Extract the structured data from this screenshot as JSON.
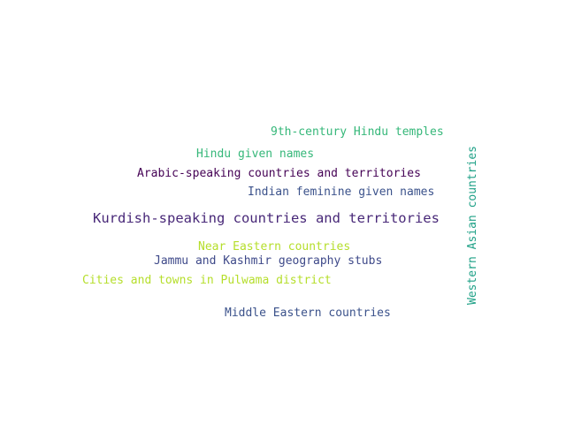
{
  "word_cloud": {
    "words": [
      {
        "text": "9th-century Hindu temples",
        "color": "#35b779"
      },
      {
        "text": "Hindu given names",
        "color": "#35b779"
      },
      {
        "text": "Arabic-speaking countries and territories",
        "color": "#440154"
      },
      {
        "text": "Indian feminine given names",
        "color": "#3b528b"
      },
      {
        "text": "Kurdish-speaking countries and territories",
        "color": "#482878"
      },
      {
        "text": "Near Eastern countries",
        "color": "#b5de2b"
      },
      {
        "text": "Jammu and Kashmir geography stubs",
        "color": "#3e4989"
      },
      {
        "text": "Cities and towns in Pulwama district",
        "color": "#b5de2b"
      },
      {
        "text": "Middle Eastern countries",
        "color": "#3b528b"
      },
      {
        "text": "Western Asian countries",
        "color": "#1fa187",
        "orientation": "vertical"
      }
    ]
  }
}
